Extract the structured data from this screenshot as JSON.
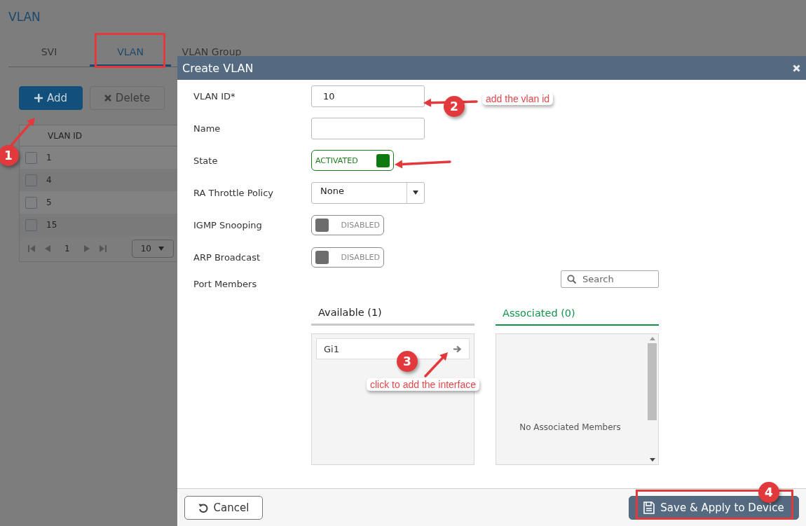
{
  "page": {
    "title": "VLAN",
    "tabs": [
      {
        "label": "SVI",
        "selected": false
      },
      {
        "label": "VLAN",
        "selected": true
      },
      {
        "label": "VLAN Group",
        "selected": false
      }
    ],
    "toolbar": [
      {
        "kind": "add",
        "label": "Add",
        "disabled": false
      },
      {
        "kind": "delete",
        "label": "Delete",
        "disabled": true
      }
    ],
    "table": {
      "columns": [
        "VLAN ID"
      ],
      "rows": [
        {
          "vlan_id": "1",
          "checked": false
        },
        {
          "vlan_id": "4",
          "checked": false
        },
        {
          "vlan_id": "5",
          "checked": false
        },
        {
          "vlan_id": "15",
          "checked": false
        }
      ]
    },
    "pagination": {
      "page": "1",
      "page_size": "10"
    }
  },
  "dialog": {
    "title": "Create VLAN",
    "fields": [
      {
        "kind": "text",
        "label": "VLAN ID*",
        "value": "10"
      },
      {
        "kind": "text",
        "label": "Name"
      },
      {
        "kind": "toggle",
        "label": "State",
        "on": true,
        "text": "ACTIVATED"
      },
      {
        "kind": "select",
        "label": "RA Throttle Policy",
        "value": "None"
      },
      {
        "kind": "toggle",
        "label": "IGMP Snooping",
        "on": false,
        "text": "DISABLED"
      },
      {
        "kind": "toggle",
        "label": "ARP Broadcast",
        "on": false,
        "text": "DISABLED"
      }
    ],
    "port_members": {
      "label": "Port Members",
      "search_placeholder": "Search",
      "lists": [
        {
          "title": "Available (1)",
          "selected": false,
          "items": [
            "Gi1"
          ]
        },
        {
          "title": "Associated (0)",
          "selected": true,
          "empty_text": "No Associated Members"
        }
      ]
    },
    "buttons": [
      {
        "kind": "cancel",
        "label": "Cancel"
      },
      {
        "kind": "save",
        "label": "Save & Apply to Device"
      }
    ]
  },
  "annotations": [
    {
      "number": "1"
    },
    {
      "number": "2",
      "text": "add the vlan id"
    },
    {
      "number": "3",
      "text": "click to add the interface"
    },
    {
      "number": "4"
    }
  ]
}
